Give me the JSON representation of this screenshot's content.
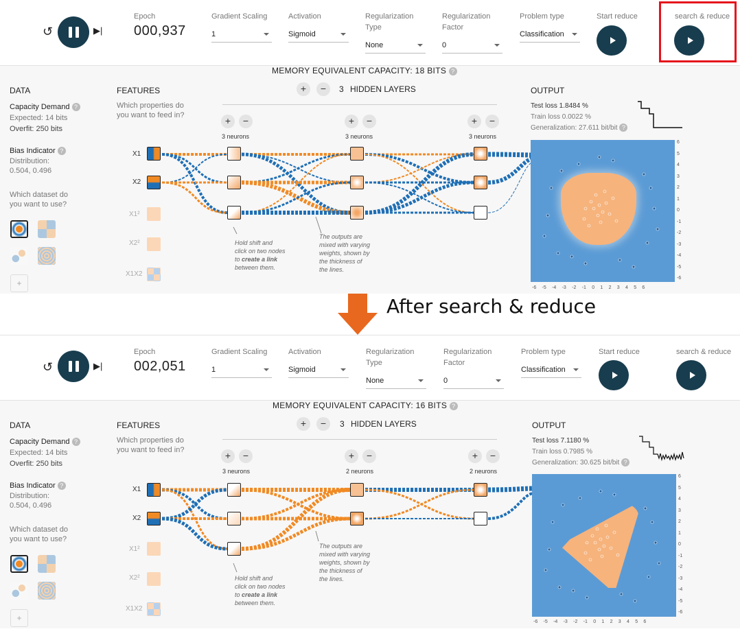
{
  "before": {
    "epoch_label": "Epoch",
    "epoch": "000,937",
    "gradient_scaling": {
      "label": "Gradient Scaling",
      "value": "1"
    },
    "activation": {
      "label": "Activation",
      "value": "Sigmoid"
    },
    "reg_type": {
      "label1": "Regularization",
      "label2": "Type",
      "value": "None"
    },
    "reg_factor": {
      "label1": "Regularization",
      "label2": "Factor",
      "value": "0"
    },
    "problem": {
      "label": "Problem type",
      "value": "Classification"
    },
    "start_reduce": "Start reduce",
    "search_reduce": "search & reduce",
    "capacity": "MEMORY EQUIVALENT CAPACITY: 18 BITS",
    "hidden_layers": "HIDDEN LAYERS",
    "layers_count": "3",
    "neurons": [
      "3 neurons",
      "3 neurons",
      "3 neurons"
    ],
    "test_loss": "Test loss 1.8484 %",
    "train_loss": "Train loss 0.0022 %",
    "generalization": "Generalization: 27.611 bit/bit"
  },
  "after": {
    "epoch_label": "Epoch",
    "epoch": "002,051",
    "gradient_scaling": {
      "label": "Gradient Scaling",
      "value": "1"
    },
    "activation": {
      "label": "Activation",
      "value": "Sigmoid"
    },
    "reg_type": {
      "label1": "Regularization",
      "label2": "Type",
      "value": "None"
    },
    "reg_factor": {
      "label1": "Regularization",
      "label2": "Factor",
      "value": "0"
    },
    "problem": {
      "label": "Problem type",
      "value": "Classification"
    },
    "start_reduce": "Start reduce",
    "search_reduce": "search & reduce",
    "capacity": "MEMORY EQUIVALENT CAPACITY: 16 BITS",
    "hidden_layers": "HIDDEN LAYERS",
    "layers_count": "3",
    "neurons": [
      "3 neurons",
      "2 neurons",
      "2 neurons"
    ],
    "test_loss": "Test loss 7.1180 %",
    "train_loss": "Train loss 0.7985 %",
    "generalization": "Generalization: 30.625 bit/bit"
  },
  "common": {
    "data": "DATA",
    "features": "FEATURES",
    "output": "OUTPUT",
    "features_q1": "Which properties do",
    "features_q2": "you want to feed in?",
    "capacity_demand": "Capacity Demand",
    "expected": "Expected: 14 bits",
    "overfit": "Overfit: 250 bits",
    "bias_indicator": "Bias Indicator",
    "distribution": "Distribution:",
    "dist_val": "0.504, 0.496",
    "dataset_q1": "Which dataset do",
    "dataset_q2": "you want to use?",
    "note1": [
      "Hold shift and",
      "click on two nodes",
      "to create a link",
      "between them."
    ],
    "note1_bold": "create a link",
    "note2": [
      "The outputs are",
      "mixed with varying",
      "weights, shown by",
      "the thickness of",
      "the lines."
    ],
    "feats": [
      "X1",
      "X2",
      "X1²",
      "X2²",
      "X1X2"
    ],
    "ticks": [
      "-6",
      "-5",
      "-4",
      "-3",
      "-2",
      "-1",
      "0",
      "1",
      "2",
      "3",
      "4",
      "5",
      "6"
    ],
    "plus": "+",
    "minus": "−",
    "add": "+"
  },
  "heading": "After search & reduce",
  "colors": {
    "blue": "#1f6fb5",
    "orange": "#f08a24",
    "dark": "#183d4e",
    "highlight": "#e5121b",
    "bg": "#f7f7f7"
  }
}
